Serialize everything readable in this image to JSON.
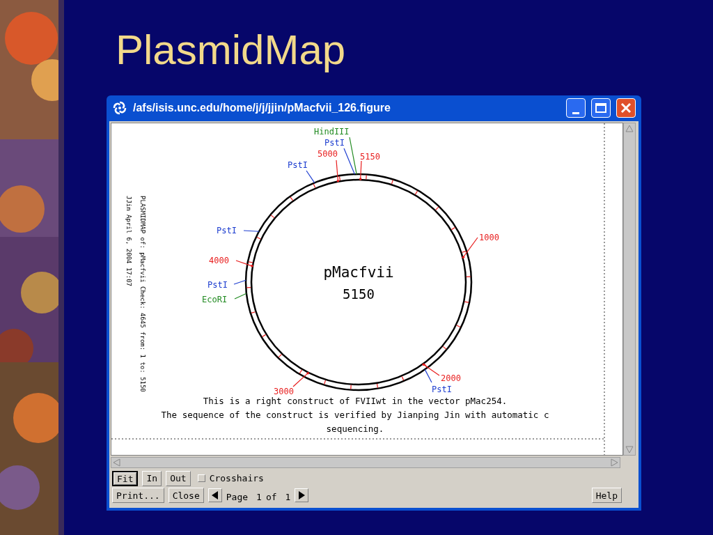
{
  "slide": {
    "title": "PlasmidMap"
  },
  "window": {
    "title": "/afs/isis.unc.edu/home/j/j/jjin/pMacfvii_126.figure"
  },
  "map": {
    "header_lines": [
      "PLASMIDMAP of: pMacfvii Check: 4645 from: 1 to: 5150",
      "JJin April 6, 2004 17:07"
    ],
    "name": "pMacfvii",
    "length": "5150",
    "sites": [
      {
        "label": "HindIII",
        "kind": "enzyme",
        "color": "#228b22"
      },
      {
        "label": "PstI",
        "kind": "enzyme",
        "color": "#1f3fd0"
      },
      {
        "label": "5000",
        "kind": "position",
        "color": "#e81c1c"
      },
      {
        "label": "5150",
        "kind": "position",
        "color": "#e81c1c"
      },
      {
        "label": "PstI",
        "kind": "enzyme",
        "color": "#1f3fd0"
      },
      {
        "label": "PstI",
        "kind": "enzyme",
        "color": "#1f3fd0"
      },
      {
        "label": "1000",
        "kind": "position",
        "color": "#e81c1c"
      },
      {
        "label": "4000",
        "kind": "position",
        "color": "#e81c1c"
      },
      {
        "label": "PstI",
        "kind": "enzyme",
        "color": "#1f3fd0"
      },
      {
        "label": "EcoRI",
        "kind": "enzyme",
        "color": "#228b22"
      },
      {
        "label": "2000",
        "kind": "position",
        "color": "#e81c1c"
      },
      {
        "label": "3000",
        "kind": "position",
        "color": "#e81c1c"
      },
      {
        "label": "PstI",
        "kind": "enzyme",
        "color": "#1f3fd0"
      }
    ],
    "caption": [
      "This is a right construct of FVIIwt in the vector pMac254.",
      "The sequence of the construct is verified by Jianping Jin with automatic c",
      "sequencing."
    ]
  },
  "toolbar": {
    "zoom_buttons": [
      {
        "label": "Fit",
        "selected": true
      },
      {
        "label": "In",
        "selected": false
      },
      {
        "label": "Out",
        "selected": false
      }
    ],
    "crosshairs": {
      "label": "Crosshairs",
      "checked": false
    },
    "print": "Print...",
    "close": "Close",
    "page_label": "Page",
    "page_current": "1",
    "page_of": "of",
    "page_total": "1",
    "help": "Help"
  }
}
